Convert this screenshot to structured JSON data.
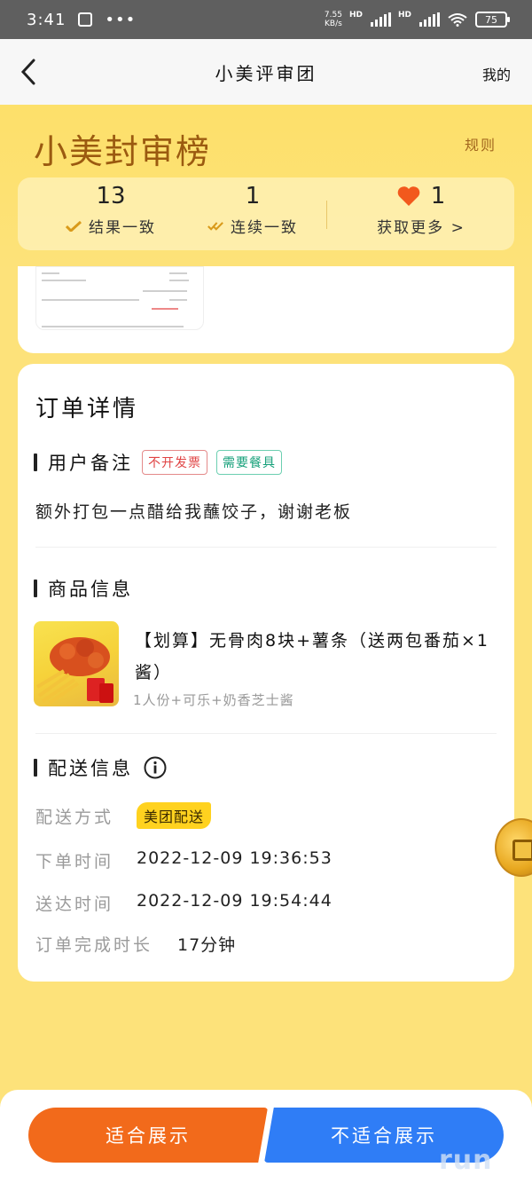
{
  "status_bar": {
    "time": "3:41",
    "dots": "•••",
    "net_speed_value": "7.55",
    "net_speed_unit": "KB/s",
    "hd1": "HD",
    "hd2": "HD",
    "battery": "75"
  },
  "nav": {
    "title": "小美评审团",
    "mine": "我的"
  },
  "hero": {
    "title": "小美封审榜",
    "rules": "规则"
  },
  "stats": {
    "result_consistent": {
      "value": "13",
      "label": "结果一致"
    },
    "streak_consistent": {
      "value": "1",
      "label": "连续一致"
    },
    "hearts": {
      "value": "1",
      "label": "获取更多 >"
    }
  },
  "order": {
    "title": "订单详情",
    "user_note": {
      "heading": "用户备注",
      "tags": [
        "不开发票",
        "需要餐具"
      ],
      "text": "额外打包一点醋给我蘸饺子，谢谢老板"
    },
    "product": {
      "heading": "商品信息",
      "name": "【划算】无骨肉8块+薯条（送两包番茄×1酱）",
      "spec": "1人份+可乐+奶香芝士酱"
    },
    "delivery": {
      "heading": "配送信息",
      "method_label": "配送方式",
      "method_value": "美团配送",
      "order_time_label": "下单时间",
      "order_time_value": "2022-12-09 19:36:53",
      "arrive_time_label": "送达时间",
      "arrive_time_value": "2022-12-09 19:54:44",
      "duration_label": "订单完成时长",
      "duration_value": "17分钟"
    }
  },
  "actions": {
    "suitable": "适合展示",
    "unsuitable": "不适合展示"
  },
  "watermark": "run",
  "colors": {
    "brand_yellow": "#fde27a",
    "hero_title": "#9b5a10",
    "suitable_button": "#f26a1b",
    "unsuitable_button": "#2f7df6",
    "heart": "#f2591d",
    "delivery_badge": "#ffd21f"
  },
  "icons": [
    "back-arrow-icon",
    "check-icon",
    "double-check-icon",
    "heart-icon",
    "info-icon",
    "coin-icon"
  ]
}
